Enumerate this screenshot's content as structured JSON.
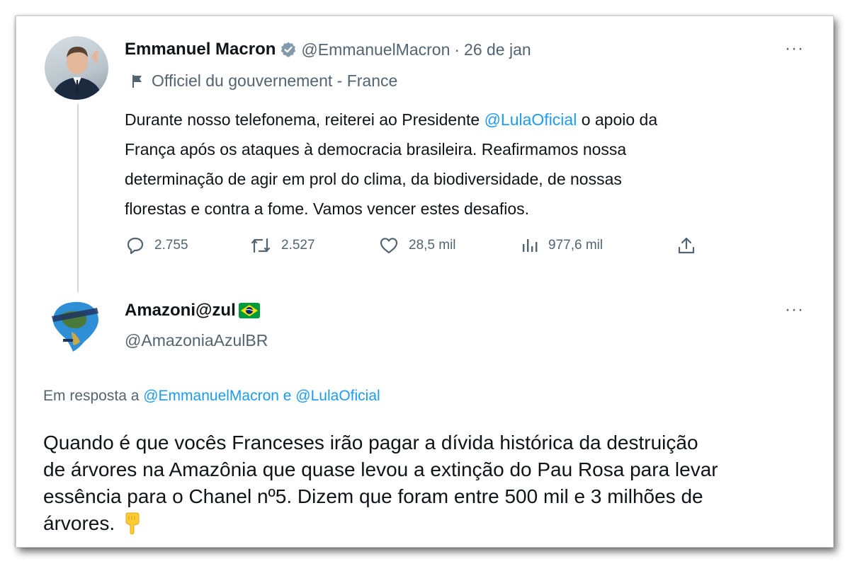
{
  "tweet": {
    "author_name": "Emmanuel Macron",
    "handle": "@EmmanuelMacron",
    "separator": "·",
    "date": "26 de jan",
    "label": "Officiel du gouvernement - France",
    "body": {
      "part1": "Durante nosso telefonema, reiterei ao Presidente ",
      "mention": "@LulaOficial",
      "part2": " o apoio da",
      "line2": "França após os ataques à democracia brasileira. Reafirmamos nossa",
      "line3": "determinação de agir em prol do clima, da biodiversidade, de nossas",
      "line4": "florestas e contra a fome. Vamos vencer estes desafios."
    },
    "stats": {
      "replies": "2.755",
      "retweets": "2.527",
      "likes": "28,5 mil",
      "views": "977,6 mil"
    },
    "more": "···"
  },
  "reply": {
    "author_name": "Amazoni@zul",
    "handle": "@AmazoniaAzulBR",
    "more": "···",
    "in_reply_prefix": "Em resposta a ",
    "in_reply_mentions": "@EmmanuelMacron e @LulaOficial",
    "body": {
      "line1": "Quando é que vocês Franceses irão pagar a dívida histórica da destruição",
      "line2": "de árvores na Amazônia que quase levou a extinção do Pau Rosa para levar",
      "line3": "essência para o Chanel nº5. Dizem que foram entre 500 mil e 3 milhões de",
      "line4": "árvores."
    },
    "emoji_icon": "pointing-down-hand-icon"
  },
  "colors": {
    "accent": "#1d9bf0",
    "text": "#0f1419",
    "muted": "#536471",
    "verified": "#829aab",
    "flag_green": "#009c3b",
    "flag_yellow": "#ffdf00",
    "flag_blue": "#002776"
  }
}
